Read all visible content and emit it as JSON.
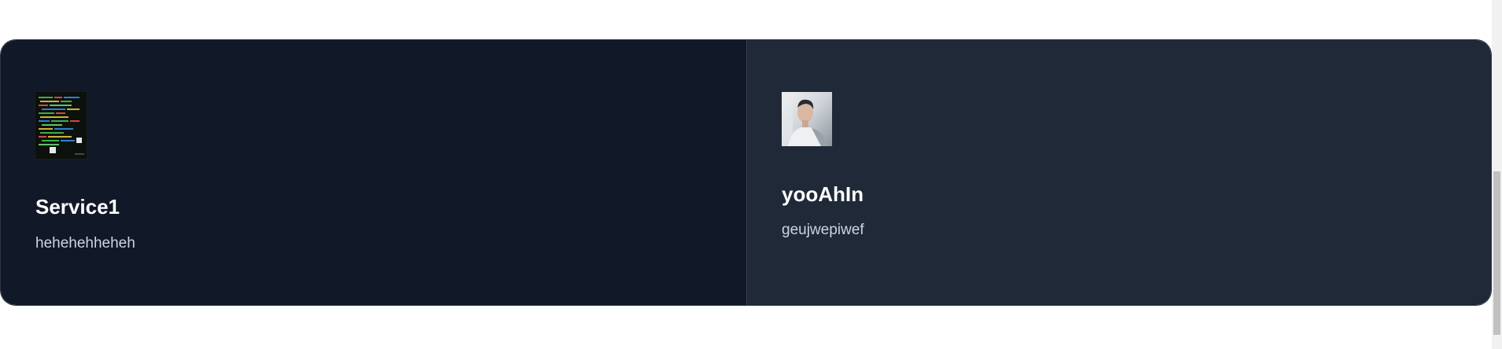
{
  "services": [
    {
      "title": "Service1",
      "description": "hehehehheheh",
      "image_icon": "code-screenshot-image"
    },
    {
      "title": "yooAhIn",
      "description": "geujwepiwef",
      "image_icon": "portrait-photo-image"
    }
  ],
  "colors": {
    "card_dark": "#111827",
    "card_light": "#1f2937",
    "title": "#ffffff",
    "description": "#cbd5e1"
  }
}
